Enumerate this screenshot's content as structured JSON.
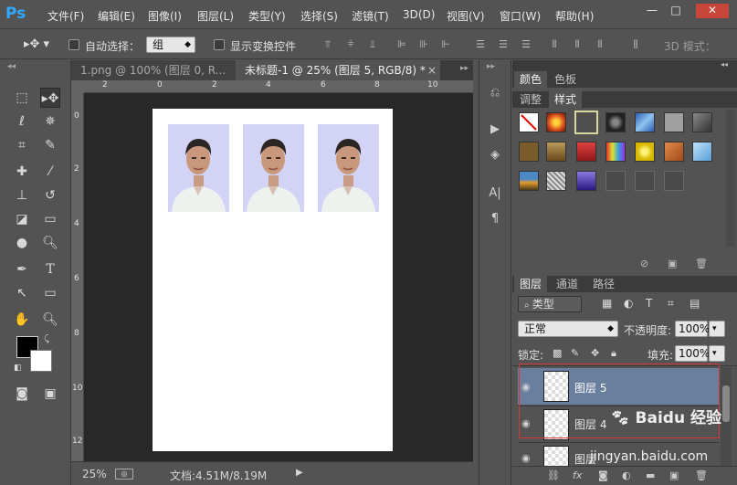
{
  "app": {
    "logo": "Ps"
  },
  "menu": [
    "文件(F)",
    "编辑(E)",
    "图像(I)",
    "图层(L)",
    "类型(Y)",
    "选择(S)",
    "滤镜(T)",
    "3D(D)",
    "视图(V)",
    "窗口(W)",
    "帮助(H)"
  ],
  "window_controls": {
    "minimize": "—",
    "maximize": "□",
    "close": "✕"
  },
  "options": {
    "auto_select_label": "自动选择：",
    "auto_select_value": "组",
    "show_transform_label": "显示变换控件",
    "mode_3d_label": "3D 模式："
  },
  "tabs": [
    {
      "label": "1.png @ 100% (图层 0, R...",
      "close": "×",
      "active": false
    },
    {
      "label": "未标题-1 @ 25% (图层 5, RGB/8) *",
      "close": "×",
      "active": true
    }
  ],
  "ruler": {
    "top": [
      "2",
      "0",
      "2",
      "4",
      "6",
      "8",
      "10"
    ],
    "left": [
      "0",
      "2",
      "4",
      "6",
      "8",
      "10",
      "12"
    ]
  },
  "status": {
    "zoom": "25%",
    "doc_info": "文档:4.51M/8.19M"
  },
  "color_panel": {
    "tabs": [
      "颜色",
      "色板"
    ]
  },
  "adjust_panel": {
    "tabs": [
      "调整",
      "样式"
    ]
  },
  "styles": {
    "swatches": [
      "#ffffff",
      "#d94a1a",
      "#c9c9c9",
      "#3a3a3a",
      "#3b77c6",
      "#a0a0a0",
      "#5a5a5a",
      "#7a5c2a",
      "#8a6a3a",
      "#c0282a",
      "#3b9bd6",
      "#d8b800",
      "#c96a2a",
      "#8abee6",
      "#4a88c6",
      "#b9b9b9",
      "#4b3fb0",
      "#4a4a4a",
      "#4a4a4a",
      "#4a4a4a"
    ]
  },
  "layers_panel": {
    "tabs": [
      "图层",
      "通道",
      "路径"
    ],
    "filter_label": "类型",
    "blend_mode": "正常",
    "opacity_label": "不透明度:",
    "opacity_value": "100%",
    "lock_label": "锁定:",
    "fill_label": "填充:",
    "fill_value": "100%",
    "layers": [
      {
        "name": "图层 5",
        "selected": true
      },
      {
        "name": "图层 4",
        "selected": false
      },
      {
        "name": "图层",
        "selected": false
      }
    ]
  },
  "watermark": {
    "brand": "Baidu 经验",
    "url": "jingyan.baidu.com"
  }
}
